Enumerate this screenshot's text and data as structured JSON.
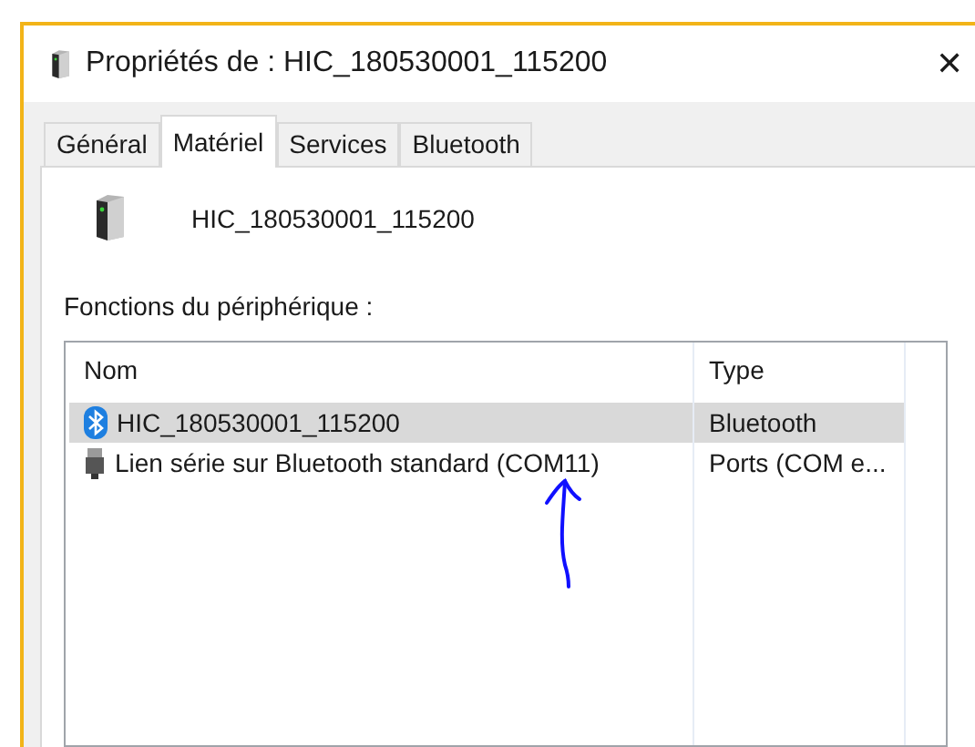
{
  "window": {
    "title": "Propriétés de : HIC_180530001_115200",
    "close": "✕"
  },
  "tabs": [
    {
      "label": "Général",
      "selected": false
    },
    {
      "label": "Matériel",
      "selected": true
    },
    {
      "label": "Services",
      "selected": false
    },
    {
      "label": "Bluetooth",
      "selected": false
    }
  ],
  "device": {
    "name": "HIC_180530001_115200"
  },
  "functions": {
    "label": "Fonctions du périphérique :",
    "columns": [
      "Nom",
      "Type"
    ],
    "rows": [
      {
        "kind": "bluetooth",
        "name": "HIC_180530001_115200",
        "type": "Bluetooth",
        "selected": true
      },
      {
        "kind": "port",
        "name": "Lien série sur Bluetooth standard (COM11)",
        "type": "Ports (COM e...",
        "selected": false
      }
    ]
  }
}
